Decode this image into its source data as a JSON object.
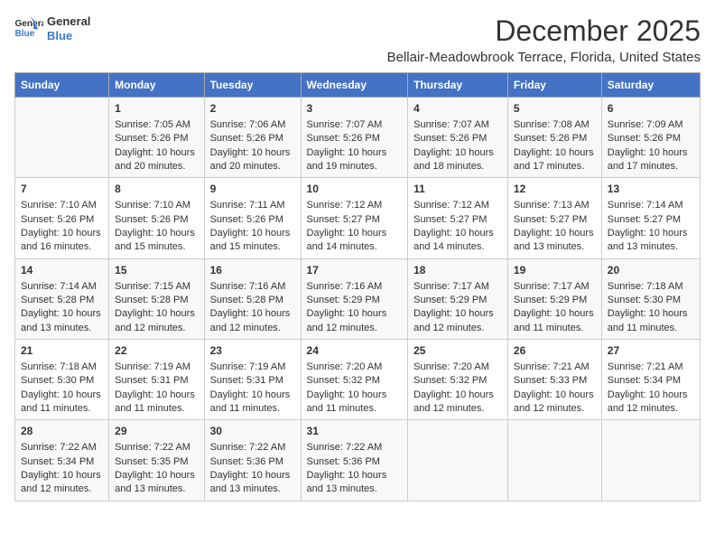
{
  "logo": {
    "line1": "General",
    "line2": "Blue"
  },
  "title": "December 2025",
  "subtitle": "Bellair-Meadowbrook Terrace, Florida, United States",
  "days_of_week": [
    "Sunday",
    "Monday",
    "Tuesday",
    "Wednesday",
    "Thursday",
    "Friday",
    "Saturday"
  ],
  "weeks": [
    [
      {
        "num": "",
        "sunrise": "",
        "sunset": "",
        "daylight": ""
      },
      {
        "num": "1",
        "sunrise": "Sunrise: 7:05 AM",
        "sunset": "Sunset: 5:26 PM",
        "daylight": "Daylight: 10 hours and 20 minutes."
      },
      {
        "num": "2",
        "sunrise": "Sunrise: 7:06 AM",
        "sunset": "Sunset: 5:26 PM",
        "daylight": "Daylight: 10 hours and 20 minutes."
      },
      {
        "num": "3",
        "sunrise": "Sunrise: 7:07 AM",
        "sunset": "Sunset: 5:26 PM",
        "daylight": "Daylight: 10 hours and 19 minutes."
      },
      {
        "num": "4",
        "sunrise": "Sunrise: 7:07 AM",
        "sunset": "Sunset: 5:26 PM",
        "daylight": "Daylight: 10 hours and 18 minutes."
      },
      {
        "num": "5",
        "sunrise": "Sunrise: 7:08 AM",
        "sunset": "Sunset: 5:26 PM",
        "daylight": "Daylight: 10 hours and 17 minutes."
      },
      {
        "num": "6",
        "sunrise": "Sunrise: 7:09 AM",
        "sunset": "Sunset: 5:26 PM",
        "daylight": "Daylight: 10 hours and 17 minutes."
      }
    ],
    [
      {
        "num": "7",
        "sunrise": "Sunrise: 7:10 AM",
        "sunset": "Sunset: 5:26 PM",
        "daylight": "Daylight: 10 hours and 16 minutes."
      },
      {
        "num": "8",
        "sunrise": "Sunrise: 7:10 AM",
        "sunset": "Sunset: 5:26 PM",
        "daylight": "Daylight: 10 hours and 15 minutes."
      },
      {
        "num": "9",
        "sunrise": "Sunrise: 7:11 AM",
        "sunset": "Sunset: 5:26 PM",
        "daylight": "Daylight: 10 hours and 15 minutes."
      },
      {
        "num": "10",
        "sunrise": "Sunrise: 7:12 AM",
        "sunset": "Sunset: 5:27 PM",
        "daylight": "Daylight: 10 hours and 14 minutes."
      },
      {
        "num": "11",
        "sunrise": "Sunrise: 7:12 AM",
        "sunset": "Sunset: 5:27 PM",
        "daylight": "Daylight: 10 hours and 14 minutes."
      },
      {
        "num": "12",
        "sunrise": "Sunrise: 7:13 AM",
        "sunset": "Sunset: 5:27 PM",
        "daylight": "Daylight: 10 hours and 13 minutes."
      },
      {
        "num": "13",
        "sunrise": "Sunrise: 7:14 AM",
        "sunset": "Sunset: 5:27 PM",
        "daylight": "Daylight: 10 hours and 13 minutes."
      }
    ],
    [
      {
        "num": "14",
        "sunrise": "Sunrise: 7:14 AM",
        "sunset": "Sunset: 5:28 PM",
        "daylight": "Daylight: 10 hours and 13 minutes."
      },
      {
        "num": "15",
        "sunrise": "Sunrise: 7:15 AM",
        "sunset": "Sunset: 5:28 PM",
        "daylight": "Daylight: 10 hours and 12 minutes."
      },
      {
        "num": "16",
        "sunrise": "Sunrise: 7:16 AM",
        "sunset": "Sunset: 5:28 PM",
        "daylight": "Daylight: 10 hours and 12 minutes."
      },
      {
        "num": "17",
        "sunrise": "Sunrise: 7:16 AM",
        "sunset": "Sunset: 5:29 PM",
        "daylight": "Daylight: 10 hours and 12 minutes."
      },
      {
        "num": "18",
        "sunrise": "Sunrise: 7:17 AM",
        "sunset": "Sunset: 5:29 PM",
        "daylight": "Daylight: 10 hours and 12 minutes."
      },
      {
        "num": "19",
        "sunrise": "Sunrise: 7:17 AM",
        "sunset": "Sunset: 5:29 PM",
        "daylight": "Daylight: 10 hours and 11 minutes."
      },
      {
        "num": "20",
        "sunrise": "Sunrise: 7:18 AM",
        "sunset": "Sunset: 5:30 PM",
        "daylight": "Daylight: 10 hours and 11 minutes."
      }
    ],
    [
      {
        "num": "21",
        "sunrise": "Sunrise: 7:18 AM",
        "sunset": "Sunset: 5:30 PM",
        "daylight": "Daylight: 10 hours and 11 minutes."
      },
      {
        "num": "22",
        "sunrise": "Sunrise: 7:19 AM",
        "sunset": "Sunset: 5:31 PM",
        "daylight": "Daylight: 10 hours and 11 minutes."
      },
      {
        "num": "23",
        "sunrise": "Sunrise: 7:19 AM",
        "sunset": "Sunset: 5:31 PM",
        "daylight": "Daylight: 10 hours and 11 minutes."
      },
      {
        "num": "24",
        "sunrise": "Sunrise: 7:20 AM",
        "sunset": "Sunset: 5:32 PM",
        "daylight": "Daylight: 10 hours and 11 minutes."
      },
      {
        "num": "25",
        "sunrise": "Sunrise: 7:20 AM",
        "sunset": "Sunset: 5:32 PM",
        "daylight": "Daylight: 10 hours and 12 minutes."
      },
      {
        "num": "26",
        "sunrise": "Sunrise: 7:21 AM",
        "sunset": "Sunset: 5:33 PM",
        "daylight": "Daylight: 10 hours and 12 minutes."
      },
      {
        "num": "27",
        "sunrise": "Sunrise: 7:21 AM",
        "sunset": "Sunset: 5:34 PM",
        "daylight": "Daylight: 10 hours and 12 minutes."
      }
    ],
    [
      {
        "num": "28",
        "sunrise": "Sunrise: 7:22 AM",
        "sunset": "Sunset: 5:34 PM",
        "daylight": "Daylight: 10 hours and 12 minutes."
      },
      {
        "num": "29",
        "sunrise": "Sunrise: 7:22 AM",
        "sunset": "Sunset: 5:35 PM",
        "daylight": "Daylight: 10 hours and 13 minutes."
      },
      {
        "num": "30",
        "sunrise": "Sunrise: 7:22 AM",
        "sunset": "Sunset: 5:36 PM",
        "daylight": "Daylight: 10 hours and 13 minutes."
      },
      {
        "num": "31",
        "sunrise": "Sunrise: 7:22 AM",
        "sunset": "Sunset: 5:36 PM",
        "daylight": "Daylight: 10 hours and 13 minutes."
      },
      {
        "num": "",
        "sunrise": "",
        "sunset": "",
        "daylight": ""
      },
      {
        "num": "",
        "sunrise": "",
        "sunset": "",
        "daylight": ""
      },
      {
        "num": "",
        "sunrise": "",
        "sunset": "",
        "daylight": ""
      }
    ]
  ]
}
